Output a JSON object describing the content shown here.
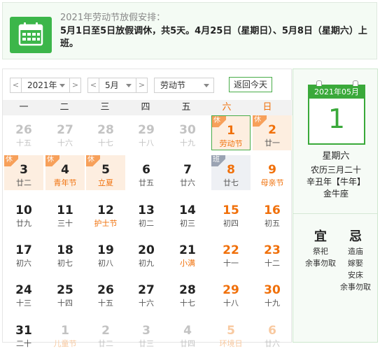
{
  "notice": {
    "title": "2021年劳动节放假安排：",
    "body": "5月1日至5日放假调休，共5天。4月25日（星期日）、5月8日（星期六）上班。"
  },
  "controls": {
    "year": "2021年",
    "month": "5月",
    "holiday": "劳动节",
    "today_button": "返回今天",
    "prev": "<",
    "next": ">"
  },
  "weekdays": [
    "一",
    "二",
    "三",
    "四",
    "五",
    "六",
    "日"
  ],
  "days": [
    {
      "n": "26",
      "s": "十五",
      "other": true
    },
    {
      "n": "27",
      "s": "十六",
      "other": true
    },
    {
      "n": "28",
      "s": "十七",
      "other": true
    },
    {
      "n": "29",
      "s": "十八",
      "other": true
    },
    {
      "n": "30",
      "s": "十九",
      "other": true
    },
    {
      "n": "1",
      "s": "劳动节",
      "we": true,
      "fest": true,
      "holiday": true,
      "selected": true,
      "tag": "休"
    },
    {
      "n": "2",
      "s": "廿一",
      "we": true,
      "holiday": true,
      "tag": "休"
    },
    {
      "n": "3",
      "s": "廿二",
      "holiday": true,
      "tag": "休"
    },
    {
      "n": "4",
      "s": "青年节",
      "fest": true,
      "holiday": true,
      "tag": "休"
    },
    {
      "n": "5",
      "s": "立夏",
      "fest": true,
      "holiday": true,
      "tag": "休"
    },
    {
      "n": "6",
      "s": "廿五"
    },
    {
      "n": "7",
      "s": "廿六"
    },
    {
      "n": "8",
      "s": "廿七",
      "we": true,
      "work": true,
      "tag": "班"
    },
    {
      "n": "9",
      "s": "母亲节",
      "we": true,
      "fest": true
    },
    {
      "n": "10",
      "s": "廿九"
    },
    {
      "n": "11",
      "s": "三十"
    },
    {
      "n": "12",
      "s": "护士节",
      "fest": true
    },
    {
      "n": "13",
      "s": "初二"
    },
    {
      "n": "14",
      "s": "初三"
    },
    {
      "n": "15",
      "s": "初四",
      "we": true
    },
    {
      "n": "16",
      "s": "初五",
      "we": true
    },
    {
      "n": "17",
      "s": "初六"
    },
    {
      "n": "18",
      "s": "初七"
    },
    {
      "n": "19",
      "s": "初八"
    },
    {
      "n": "20",
      "s": "初九"
    },
    {
      "n": "21",
      "s": "小满",
      "fest": true
    },
    {
      "n": "22",
      "s": "十一",
      "we": true
    },
    {
      "n": "23",
      "s": "十二",
      "we": true
    },
    {
      "n": "24",
      "s": "十三"
    },
    {
      "n": "25",
      "s": "十四"
    },
    {
      "n": "26",
      "s": "十五"
    },
    {
      "n": "27",
      "s": "十六"
    },
    {
      "n": "28",
      "s": "十七"
    },
    {
      "n": "29",
      "s": "十八",
      "we": true
    },
    {
      "n": "30",
      "s": "十九",
      "we": true
    },
    {
      "n": "31",
      "s": "二十"
    },
    {
      "n": "1",
      "s": "儿童节",
      "other": true,
      "fest": true
    },
    {
      "n": "2",
      "s": "廿二",
      "other": true
    },
    {
      "n": "3",
      "s": "廿三",
      "other": true
    },
    {
      "n": "4",
      "s": "廿四",
      "other": true
    },
    {
      "n": "5",
      "s": "环境日",
      "other": true,
      "we": true,
      "fest": true
    },
    {
      "n": "6",
      "s": "廿六",
      "other": true,
      "we": true
    }
  ],
  "side": {
    "page_header": "2021年05月",
    "page_day": "1",
    "weekday": "星期六",
    "lunar": "农历三月二十",
    "ganzhi": "辛丑年【牛年】",
    "zodiac": "金牛座",
    "yi_title": "宜",
    "ji_title": "忌",
    "yi": [
      "祭祀",
      "余事勿取"
    ],
    "ji": [
      "造庙",
      "嫁娶",
      "安床",
      "余事勿取"
    ]
  }
}
